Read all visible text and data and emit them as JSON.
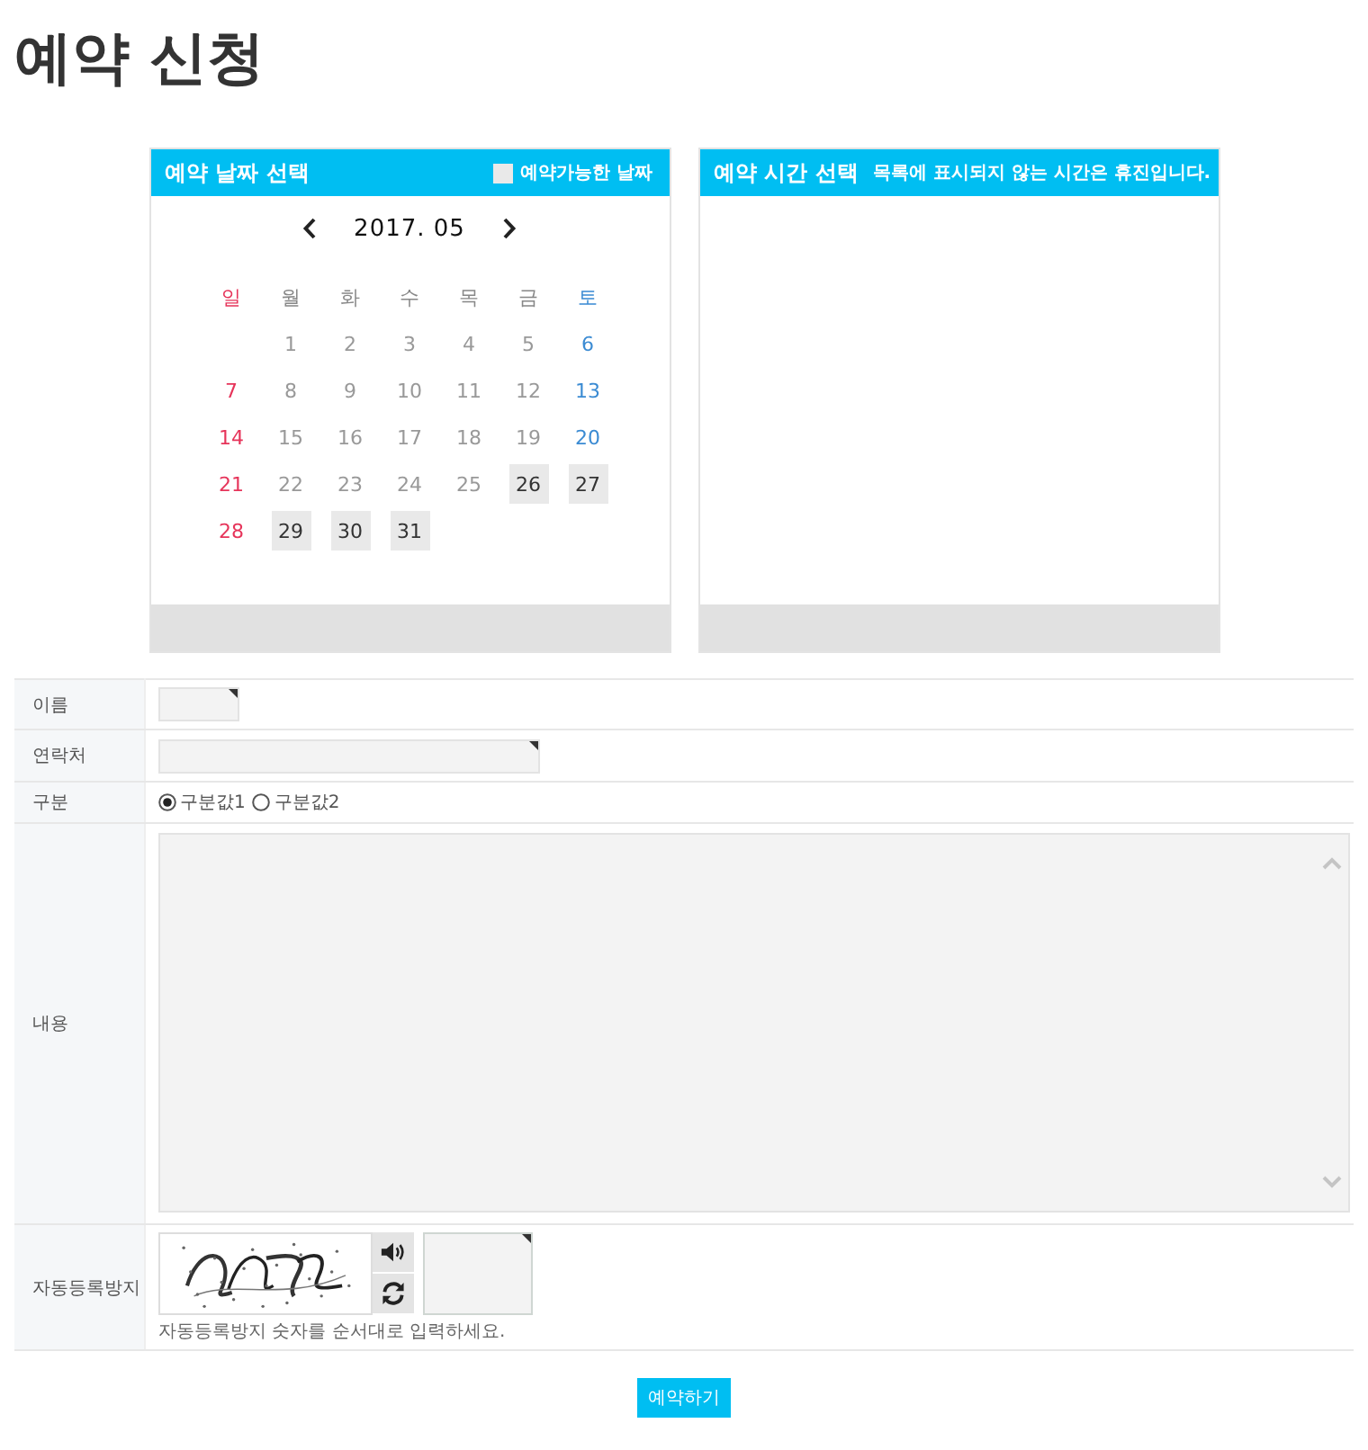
{
  "page_title": "예약 신청",
  "date_panel": {
    "title": "예약 날짜 선택",
    "legend": "예약가능한 날짜",
    "month": "2017. 05",
    "weekdays": [
      {
        "label": "일",
        "kind": "sun"
      },
      {
        "label": "월",
        "kind": "mon"
      },
      {
        "label": "화",
        "kind": "tue"
      },
      {
        "label": "수",
        "kind": "wed"
      },
      {
        "label": "목",
        "kind": "thu"
      },
      {
        "label": "금",
        "kind": "fri"
      },
      {
        "label": "토",
        "kind": "sat"
      }
    ],
    "days": [
      {
        "label": "1",
        "kind": "mon",
        "available": false
      },
      {
        "label": "2",
        "kind": "tue",
        "available": false
      },
      {
        "label": "3",
        "kind": "wed",
        "available": false
      },
      {
        "label": "4",
        "kind": "thu",
        "available": false
      },
      {
        "label": "5",
        "kind": "fri",
        "available": false
      },
      {
        "label": "6",
        "kind": "sat",
        "available": false
      },
      {
        "label": "7",
        "kind": "sun",
        "available": false
      },
      {
        "label": "8",
        "kind": "mon",
        "available": false
      },
      {
        "label": "9",
        "kind": "tue",
        "available": false
      },
      {
        "label": "10",
        "kind": "wed",
        "available": false
      },
      {
        "label": "11",
        "kind": "thu",
        "available": false
      },
      {
        "label": "12",
        "kind": "fri",
        "available": false
      },
      {
        "label": "13",
        "kind": "sat",
        "available": false
      },
      {
        "label": "14",
        "kind": "sun",
        "available": false
      },
      {
        "label": "15",
        "kind": "mon",
        "available": false
      },
      {
        "label": "16",
        "kind": "tue",
        "available": false
      },
      {
        "label": "17",
        "kind": "wed",
        "available": false
      },
      {
        "label": "18",
        "kind": "thu",
        "available": false
      },
      {
        "label": "19",
        "kind": "fri",
        "available": false
      },
      {
        "label": "20",
        "kind": "sat",
        "available": false
      },
      {
        "label": "21",
        "kind": "sun",
        "available": false
      },
      {
        "label": "22",
        "kind": "mon",
        "available": false
      },
      {
        "label": "23",
        "kind": "tue",
        "available": false
      },
      {
        "label": "24",
        "kind": "wed",
        "available": false
      },
      {
        "label": "25",
        "kind": "thu",
        "available": false
      },
      {
        "label": "26",
        "kind": "fri",
        "available": true
      },
      {
        "label": "27",
        "kind": "sat",
        "available": true
      },
      {
        "label": "28",
        "kind": "sun",
        "available": false
      },
      {
        "label": "29",
        "kind": "mon",
        "available": true
      },
      {
        "label": "30",
        "kind": "tue",
        "available": true
      },
      {
        "label": "31",
        "kind": "wed",
        "available": true
      }
    ]
  },
  "time_panel": {
    "title": "예약 시간 선택",
    "notice": "목록에 표시되지 않는 시간은 휴진입니다."
  },
  "form": {
    "rows": [
      {
        "label": "이름",
        "kind": "short",
        "required": true
      },
      {
        "label": "연락처",
        "kind": "wide",
        "required": true
      },
      {
        "label": "구분",
        "kind": "choice",
        "options": [
          {
            "label": "구분값1",
            "selected": true
          },
          {
            "label": "구분값2",
            "selected": false
          }
        ]
      },
      {
        "label": "내용",
        "kind": "memo"
      },
      {
        "label": "자동등록방지",
        "kind": "captcha",
        "required": true,
        "hint": "자동등록방지 숫자를 순서대로 입력하세요."
      }
    ]
  },
  "submit": {
    "label": "예약하기"
  }
}
